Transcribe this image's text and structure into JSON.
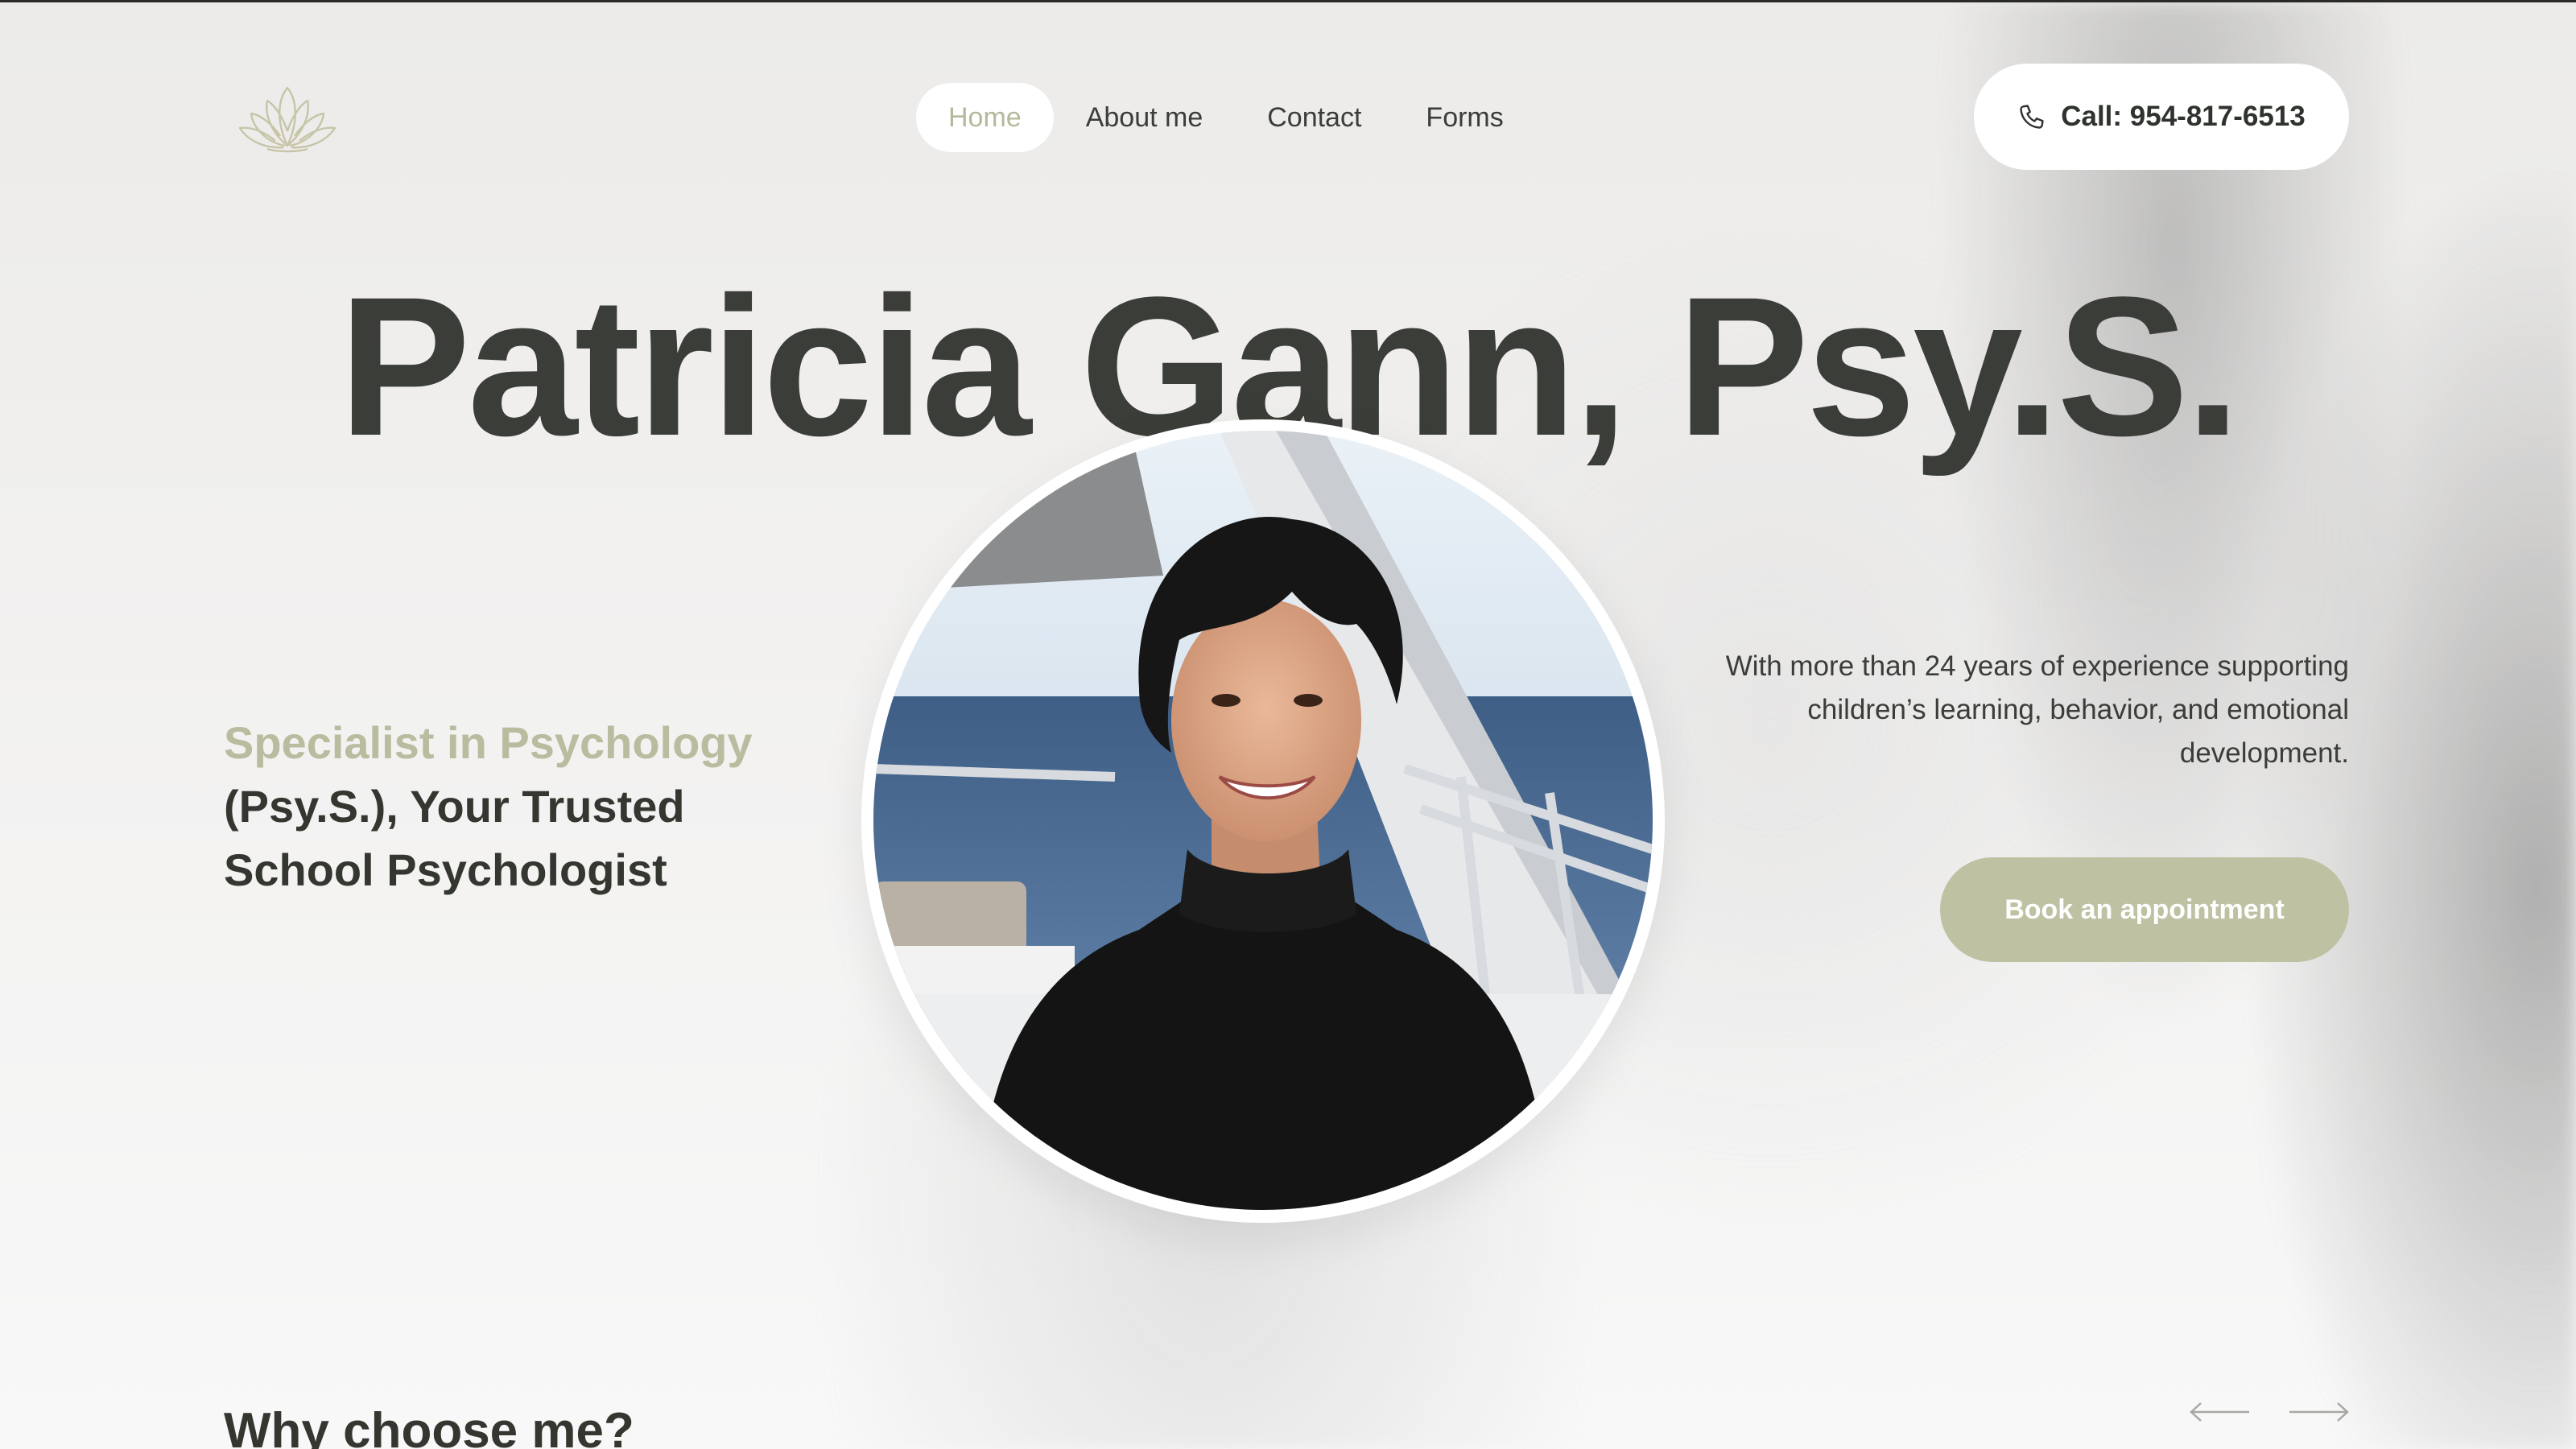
{
  "nav": {
    "items": [
      {
        "label": "Home",
        "active": true
      },
      {
        "label": "About me",
        "active": false
      },
      {
        "label": "Contact",
        "active": false
      },
      {
        "label": "Forms",
        "active": false
      }
    ]
  },
  "header": {
    "logo_icon": "lotus-icon",
    "call_label": "Call: 954-817-6513",
    "call_icon": "phone-icon"
  },
  "hero": {
    "title": "Patricia Gann, Psy.S.",
    "specialist_accent": "Specialist in Psychology",
    "specialist_rest": "(Psy.S.), Your Trusted School Psychologist",
    "experience": "With more than 24 years of experience supporting children’s learning, behavior, and emotional development.",
    "book_label": "Book an appointment"
  },
  "section": {
    "why_title": "Why choose me?",
    "prev_icon": "arrow-left-icon",
    "next_icon": "arrow-right-icon"
  },
  "colors": {
    "accent": "#b9bc9f",
    "text_dark": "#3a3d38",
    "button_bg": "#bfc1a3"
  }
}
